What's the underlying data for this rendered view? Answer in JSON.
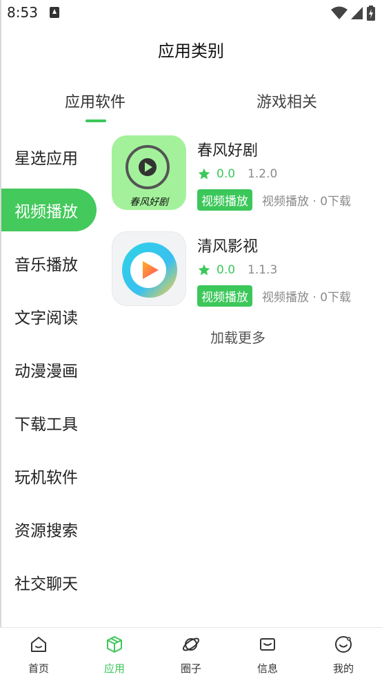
{
  "status_bar": {
    "time": "8:53",
    "icons": [
      "notification-a-icon",
      "wifi-icon",
      "signal-icon",
      "battery-charging-icon"
    ]
  },
  "page": {
    "title": "应用类别"
  },
  "tabs": [
    {
      "label": "应用软件",
      "active": true
    },
    {
      "label": "游戏相关",
      "active": false
    }
  ],
  "categories": [
    {
      "label": "星选应用",
      "active": false
    },
    {
      "label": "视频播放",
      "active": true
    },
    {
      "label": "音乐播放",
      "active": false
    },
    {
      "label": "文字阅读",
      "active": false
    },
    {
      "label": "动漫漫画",
      "active": false
    },
    {
      "label": "下载工具",
      "active": false
    },
    {
      "label": "玩机软件",
      "active": false
    },
    {
      "label": "资源搜索",
      "active": false
    },
    {
      "label": "社交聊天",
      "active": false
    }
  ],
  "apps": [
    {
      "name": "春风好剧",
      "icon_text": "春风好剧",
      "icon": "play-circle-icon",
      "rating": "0.0",
      "version": "1.2.0",
      "tag": "视频播放",
      "meta": "视频播放 · 0下载"
    },
    {
      "name": "清风影视",
      "icon": "play-gradient-icon",
      "rating": "0.0",
      "version": "1.1.3",
      "tag": "视频播放",
      "meta": "视频播放 · 0下载"
    }
  ],
  "load_more": "加载更多",
  "bottom_nav": [
    {
      "label": "首页",
      "icon": "home-icon",
      "active": false
    },
    {
      "label": "应用",
      "icon": "cube-icon",
      "active": true
    },
    {
      "label": "圈子",
      "icon": "planet-icon",
      "active": false
    },
    {
      "label": "信息",
      "icon": "message-icon",
      "active": false
    },
    {
      "label": "我的",
      "icon": "profile-icon",
      "active": false
    }
  ],
  "colors": {
    "accent": "#3cc75a",
    "text": "#222222",
    "muted": "#8a8a8a"
  }
}
